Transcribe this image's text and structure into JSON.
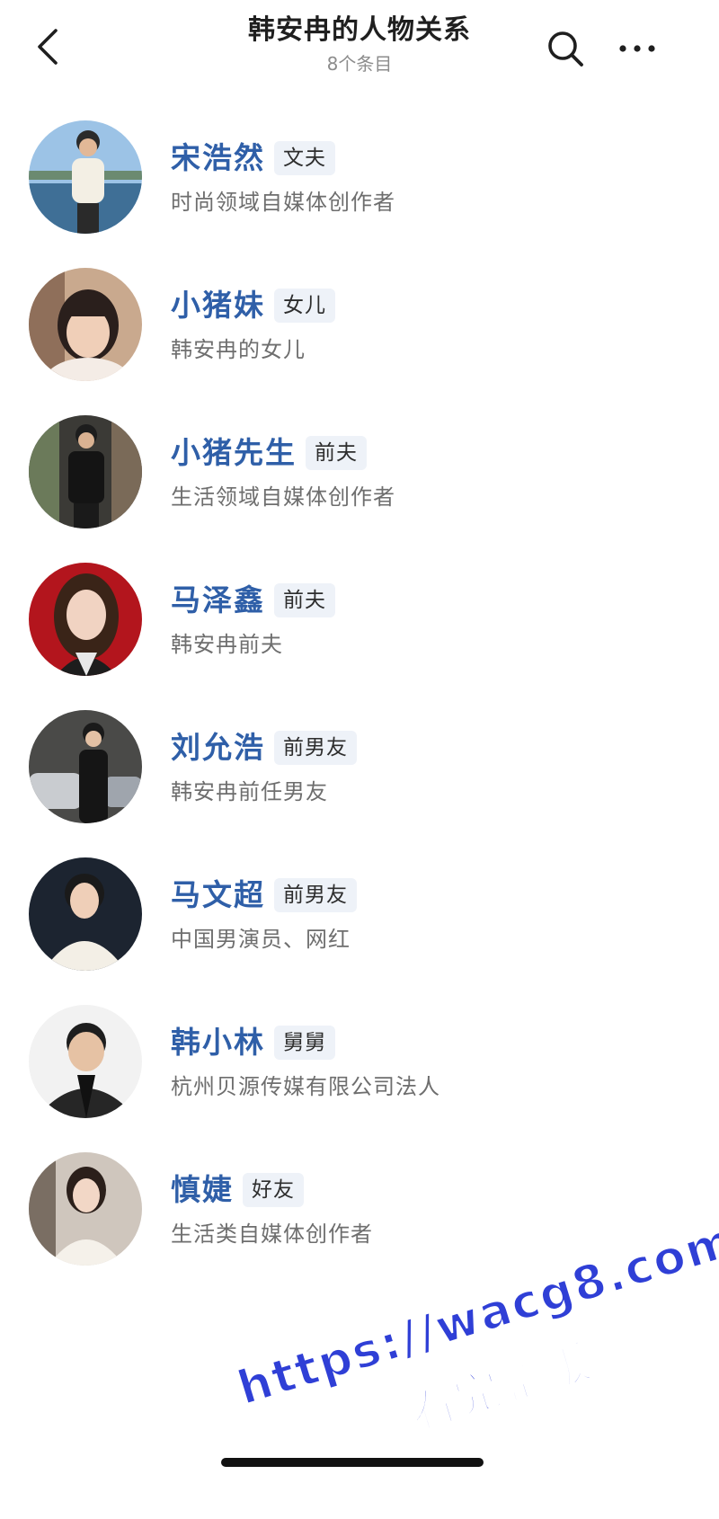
{
  "header": {
    "title": "韩安冉的人物关系",
    "subtitle": "8个条目",
    "back_icon": "chevron-left-icon",
    "search_icon": "search-icon",
    "more_icon": "more-horizontal-icon"
  },
  "colors": {
    "name": "#2f5fa8",
    "tag_bg": "#eef2f8",
    "desc": "#6e6e6e",
    "watermark": "#2f3fd6"
  },
  "people": [
    {
      "name": "宋浩然",
      "tag": "文夫",
      "desc": "时尚领域自媒体创作者"
    },
    {
      "name": "小猪妹",
      "tag": "女儿",
      "desc": "韩安冉的女儿"
    },
    {
      "name": "小猪先生",
      "tag": "前夫",
      "desc": "生活领域自媒体创作者"
    },
    {
      "name": "马泽鑫",
      "tag": "前夫",
      "desc": "韩安冉前夫"
    },
    {
      "name": "刘允浩",
      "tag": "前男友",
      "desc": "韩安冉前任男友"
    },
    {
      "name": "马文超",
      "tag": "前男友",
      "desc": "中国男演员、网红"
    },
    {
      "name": "韩小林",
      "tag": "舅舅",
      "desc": "杭州贝源传媒有限公司法人"
    },
    {
      "name": "慎婕",
      "tag": "好友",
      "desc": "生活类自媒体创作者"
    }
  ],
  "watermark": {
    "url": "https://wacg8.com",
    "text": "看完整版"
  }
}
